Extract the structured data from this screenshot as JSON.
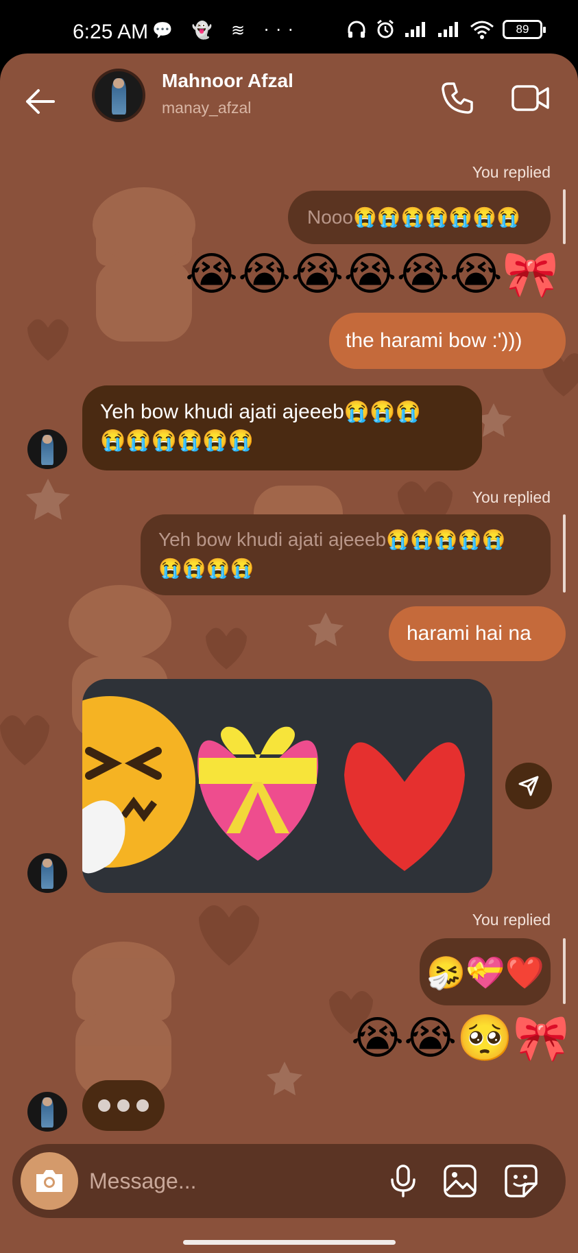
{
  "status_bar": {
    "time": "6:25 AM",
    "left_icons": "💬 👻 ≋ ···",
    "battery": "89"
  },
  "header": {
    "name": "Mahnoor Afzal",
    "username": "manay_afzal"
  },
  "messages": {
    "reply_label": "You replied",
    "m1_quote": "Nooo😭😭😭😭😭😭😭",
    "m1_emoji": "😭😭😭😭😭😭🎀",
    "m2": "the harami bow :')))",
    "m3_line1": "Yeh bow khudi ajati ajeeeb😭😭😭",
    "m3_line2": "😭😭😭😭😭😭",
    "m4_quote_line1": "Yeh bow khudi ajati ajeeeb😭😭😭😭😭",
    "m4_quote_line2": "😭😭😭😭",
    "m5": "harami hai na",
    "m6_quote": "🤧💝❤️",
    "m6_emoji": "😭😭🥺🎀"
  },
  "composer": {
    "placeholder": "Message..."
  },
  "colors": {
    "background": "#8a513b",
    "my_bubble": "#c56a3b",
    "their_bubble": "#4a2a12",
    "quoted_bubble": "#5b3421"
  }
}
